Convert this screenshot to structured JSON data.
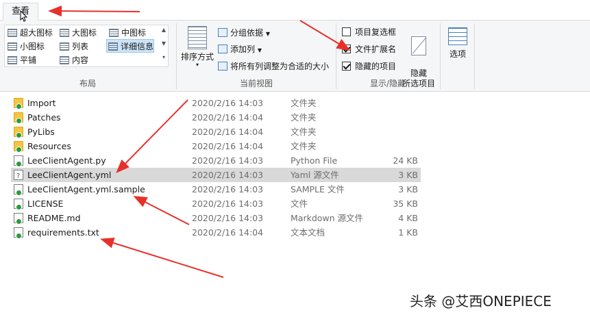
{
  "tabs": {
    "view_label": "查看"
  },
  "ribbon": {
    "layout": {
      "items": [
        "超大图标",
        "大图标",
        "中图标",
        "小图标",
        "列表",
        "详细信息",
        "平铺",
        "内容"
      ],
      "selected": "详细信息",
      "group_label": "布局"
    },
    "current_view": {
      "sort_label": "排序方式",
      "group_by": "分组依据",
      "add_column": "添加列",
      "fit_columns": "将所有列调整为合适的大小",
      "group_label": "当前视图"
    },
    "show_hide": {
      "item_checkboxes": {
        "label": "项目复选框",
        "checked": false
      },
      "file_extensions": {
        "label": "文件扩展名",
        "checked": true
      },
      "hidden_items": {
        "label": "隐藏的项目",
        "checked": true
      },
      "hide_selected": "隐藏\n所选项目",
      "group_label": "显示/隐藏"
    },
    "options": {
      "label": "选项"
    }
  },
  "files": [
    {
      "name": "Import",
      "date": "2020/2/16 14:03",
      "type": "文件夹",
      "size": "",
      "icon": "folder-icon"
    },
    {
      "name": "Patches",
      "date": "2020/2/16 14:04",
      "type": "文件夹",
      "size": "",
      "icon": "folder-icon"
    },
    {
      "name": "PyLibs",
      "date": "2020/2/16 14:04",
      "type": "文件夹",
      "size": "",
      "icon": "folder-icon"
    },
    {
      "name": "Resources",
      "date": "2020/2/16 14:04",
      "type": "文件夹",
      "size": "",
      "icon": "folder-icon"
    },
    {
      "name": "LeeClientAgent.py",
      "date": "2020/2/16 14:03",
      "type": "Python File",
      "size": "24 KB",
      "icon": "python-file-icon"
    },
    {
      "name": "LeeClientAgent.yml",
      "date": "2020/2/16 14:03",
      "type": "Yaml 源文件",
      "size": "3 KB",
      "icon": "unknown-file-icon",
      "selected": true
    },
    {
      "name": "LeeClientAgent.yml.sample",
      "date": "2020/2/16 14:03",
      "type": "SAMPLE 文件",
      "size": "3 KB",
      "icon": "file-icon"
    },
    {
      "name": "LICENSE",
      "date": "2020/2/16 14:03",
      "type": "文件",
      "size": "35 KB",
      "icon": "file-icon"
    },
    {
      "name": "README.md",
      "date": "2020/2/16 14:03",
      "type": "Markdown 源文件",
      "size": "4 KB",
      "icon": "file-icon"
    },
    {
      "name": "requirements.txt",
      "date": "2020/2/16 14:04",
      "type": "文本文档",
      "size": "1 KB",
      "icon": "text-file-icon"
    }
  ],
  "watermark": "头条 @艾西ONEPIECE",
  "colors": {
    "arrow": "#e8302b",
    "selected_row": "#d9d9d9",
    "ribbon_bg": "#f5f6f7",
    "folder": "#f5c542",
    "sync_badge": "#2c9a3c"
  }
}
